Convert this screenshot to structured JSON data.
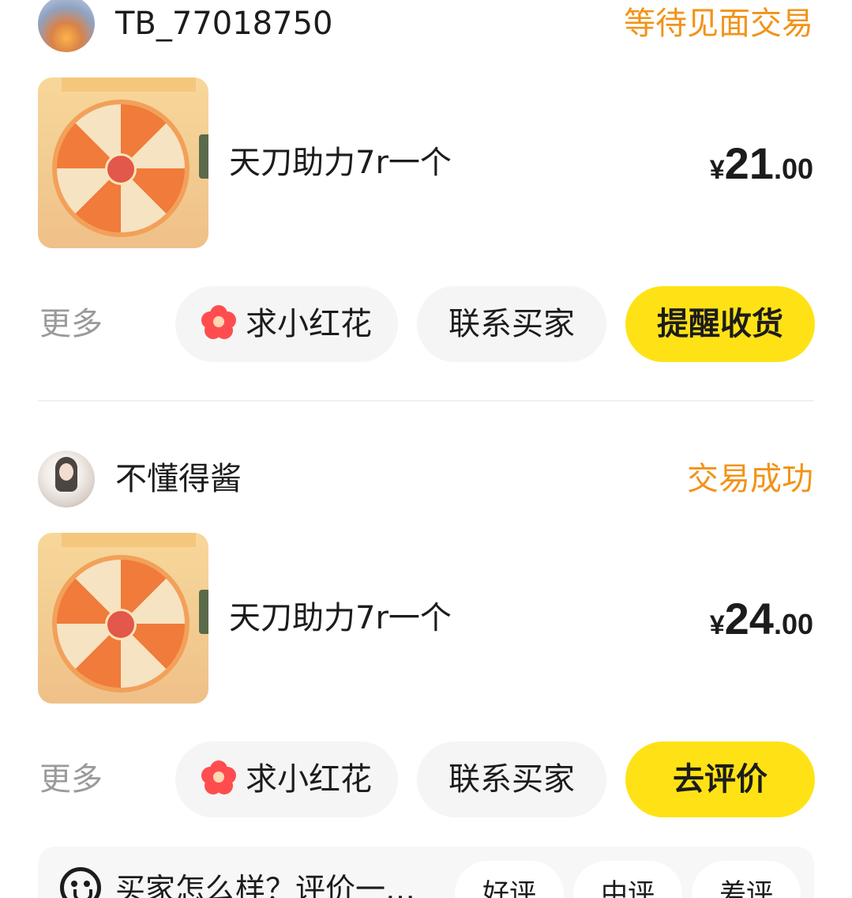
{
  "orders": [
    {
      "username": "TB_77018750",
      "status": "等待见面交易",
      "item_title": "天刀助力7r一个",
      "price": {
        "currency": "¥",
        "integer": "21",
        "decimal": ".00"
      },
      "actions": {
        "more": "更多",
        "flower": "求小红花",
        "contact": "联系买家",
        "primary": "提醒收货"
      }
    },
    {
      "username": "不懂得酱",
      "status": "交易成功",
      "item_title": "天刀助力7r一个",
      "price": {
        "currency": "¥",
        "integer": "24",
        "decimal": ".00"
      },
      "actions": {
        "more": "更多",
        "flower": "求小红花",
        "contact": "联系买家",
        "primary": "去评价"
      }
    }
  ],
  "review": {
    "prompt": "买家怎么样？评价一…",
    "options": [
      "好评",
      "中评",
      "差评"
    ]
  },
  "colors": {
    "status_orange": "#f29319",
    "primary_yellow": "#ffe215",
    "flower_red": "#ff4d4f",
    "muted_text": "#9a9a9a"
  },
  "icons": [
    "flower-icon",
    "review-face-icon"
  ]
}
